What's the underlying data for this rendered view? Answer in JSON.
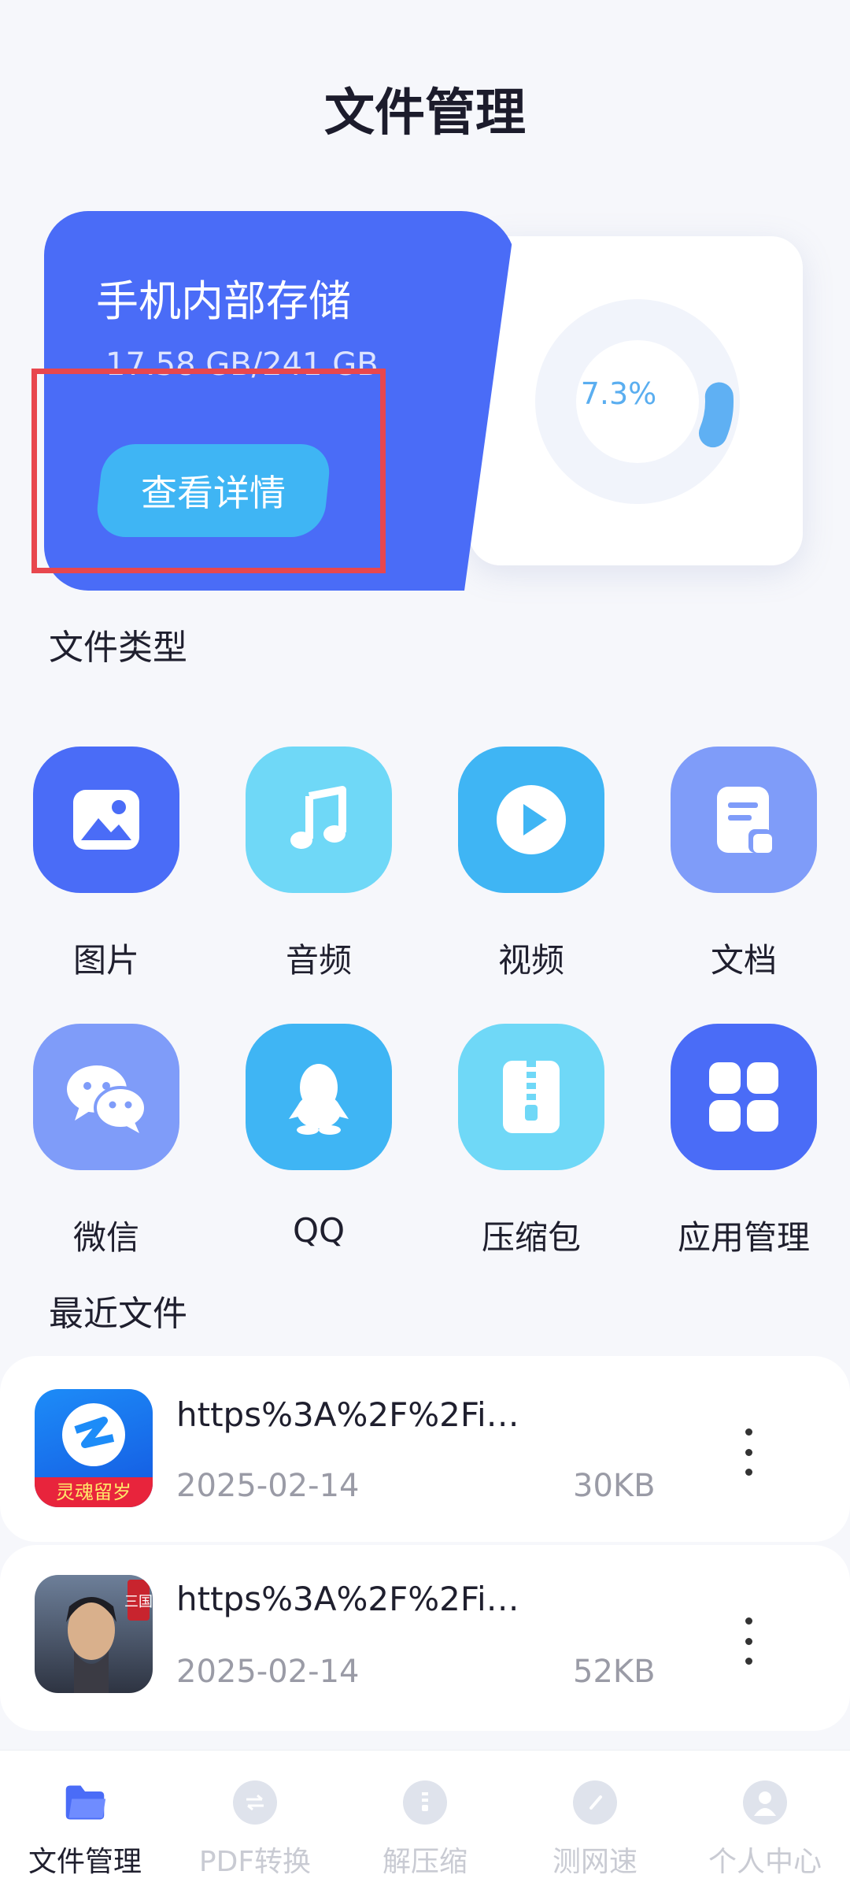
{
  "header": {
    "title": "文件管理"
  },
  "storage": {
    "title": "手机内部存储",
    "usage": "17.58 GB/241 GB",
    "button_label": "查看详情",
    "percent_label": "7.3%",
    "percent_value": 7.3,
    "colors": {
      "card": "#4a6cf7",
      "button": "#3fb5f4",
      "ring": "#5fb0f3"
    }
  },
  "file_types": {
    "title": "文件类型",
    "items": [
      {
        "label": "图片",
        "icon": "image-icon",
        "color": "#4a6cf7"
      },
      {
        "label": "音频",
        "icon": "music-note-icon",
        "color": "#6fd8f7"
      },
      {
        "label": "视频",
        "icon": "play-icon",
        "color": "#3fb5f4"
      },
      {
        "label": "文档",
        "icon": "document-icon",
        "color": "#7f9cf9"
      },
      {
        "label": "微信",
        "icon": "wechat-icon",
        "color": "#7f9cf9"
      },
      {
        "label": "QQ",
        "icon": "qq-icon",
        "color": "#3fb5f4"
      },
      {
        "label": "压缩包",
        "icon": "zip-icon",
        "color": "#6fd8f7"
      },
      {
        "label": "应用管理",
        "icon": "apps-grid-icon",
        "color": "#4a6cf7"
      }
    ]
  },
  "recent_files": {
    "title": "最近文件",
    "items": [
      {
        "name": "https%3A%2F%2Fi…",
        "date": "2025-02-14",
        "size": "30KB",
        "thumb_text": "灵魂留岁"
      },
      {
        "name": "https%3A%2F%2Fi…",
        "date": "2025-02-14",
        "size": "52KB",
        "thumb_text": "三国"
      }
    ]
  },
  "bottom_nav": {
    "items": [
      {
        "label": "文件管理",
        "icon": "folder-icon",
        "active": true
      },
      {
        "label": "PDF转换",
        "icon": "convert-icon",
        "active": false
      },
      {
        "label": "解压缩",
        "icon": "zip-icon",
        "active": false
      },
      {
        "label": "测网速",
        "icon": "speedometer-icon",
        "active": false
      },
      {
        "label": "个人中心",
        "icon": "person-icon",
        "active": false
      }
    ]
  }
}
